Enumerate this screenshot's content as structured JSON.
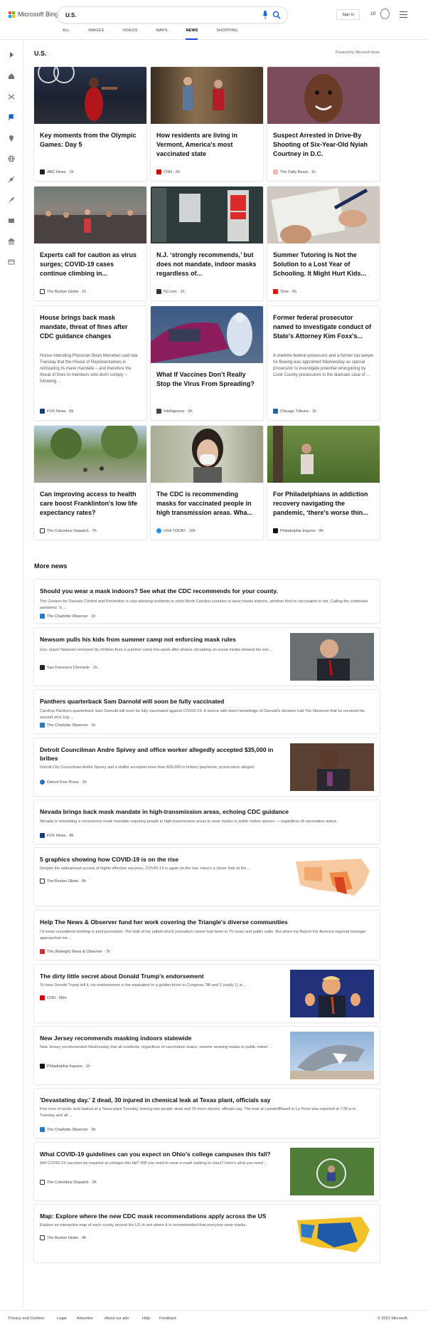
{
  "header": {
    "brand": "Microsoft Bing",
    "query": "U.S.",
    "sign_in": "Sign in",
    "points": "10",
    "tabs": [
      "ALL",
      "IMAGES",
      "VIDEOS",
      "MAPS",
      "NEWS",
      "SHOPPING"
    ]
  },
  "section": {
    "title": "U.S.",
    "powered_by": "Powered by Microsoft News"
  },
  "cards": [
    {
      "headline": "Key moments from the Olympic Games: Day 5",
      "source": "ABC News · 1h",
      "color": "#7b1416"
    },
    {
      "headline": "How residents are living in Vermont, America's most vaccinated state",
      "source": "CNN · 2h",
      "color": "#7a6650"
    },
    {
      "headline": "Suspect Arrested in Drive-By Shooting of Six-Year-Old Nyiah Courtney in D.C.",
      "source": "The Daily Beast · 1h",
      "color": "#6d4a4b"
    },
    {
      "headline": "Experts call for caution as virus surges; COVID-19 cases continue climbing in...",
      "source": "The Boston Globe · 1h",
      "color": "#5a5450"
    },
    {
      "headline": "N.J. ‘strongly recommends,’ but does not mandate, indoor masks regardless of...",
      "source": "NJ.com · 1h",
      "color": "#344143"
    },
    {
      "headline": "Summer Tutoring Is Not the Solution to a Lost Year of Schooling. It Might Hurt Kids...",
      "source": "Time · 5h",
      "color": "#c8c2bb"
    },
    {
      "headline": "House brings back mask mandate, threat of fines after CDC guidance changes",
      "snippet": "House Attending Physician Brian Monahan said late Tuesday that the House of Representatives is reinstating its mask mandate – and therefore the threat of fines to members who don't comply – following ...",
      "source": "FOX News · 5h"
    },
    {
      "headline": "What If Vaccines Don’t Really Stop the Virus From Spreading?",
      "source": "Intelligencer · 6h",
      "color": "#2b4f82"
    },
    {
      "headline": "Former federal prosecutor named to investigate conduct of State's Attorney Kim Foxx's...",
      "snippet": "A onetime federal prosecutor and a former top lawyer for Boeing was appointed Wednesday as special prosecutor to investigate potential wrongdoing by Cook County prosecutors in the dramatic case of ...",
      "source": "Chicago Tribune · 1h"
    },
    {
      "headline": "Can improving access to health care boost Franklinton's low life expectancy rates?",
      "source": "The Columbus Dispatch · 7h",
      "color": "#60774c"
    },
    {
      "headline": "The CDC is recommending masks for vaccinated people in high transmission areas. Wha...",
      "source": "USA TODAY · 10h",
      "color": "#8a8477"
    },
    {
      "headline": "For Philadelphians in addiction recovery navigating the pandemic, ‘there's worse thin...",
      "source": "Philadelphia Inquirer · 8h",
      "color": "#536d3b"
    }
  ],
  "more_news": {
    "title": "More news",
    "items": [
      {
        "title": "Should you wear a mask indoors? See what the CDC recommends for your county.",
        "snippet": "The Centers for Disease Control and Prevention is now advising residents in most North Carolina counties to wear masks indoors, whether they're vaccinated or not. Calling the continued pandemic \"a ...",
        "source": "The Charlotte Observer · 1h"
      },
      {
        "title": "Newsom pulls his kids from summer camp not enforcing mask rules",
        "snippet": "Gov. Gavin Newsom removed his children from a summer camp this week after photos circulating on social media showed his son ...",
        "source": "San Francisco Chronicle · 1h"
      },
      {
        "title": "Panthers quarterback Sam Darnold will soon be fully vaccinated",
        "snippet": "Carolina Panthers quarterback Sam Darnold will soon be fully vaccinated against COVID-19. A source with direct knowledge of Darnold's decision told The Observer that he received his second shot July ...",
        "source": "The Charlotte Observer · 1h"
      },
      {
        "title": "Detroit Councilman Andre Spivey and office worker allegedly accepted $35,000 in bribes",
        "snippet": "Detroit City Councilman Andre Spivey and a staffer accepted more than $35,000 in bribery payments, prosecutors alleged.",
        "source": "Detroit Free Press · 2h"
      },
      {
        "title": "Nevada brings back mask mandate in high-transmission areas, echoing CDC guidance",
        "snippet": "Nevada is reinstating a coronavirus mask mandate requiring people in high-transmission areas to wear masks in public indoor spaces — regardless of vaccination status.",
        "source": "FOX News · 8h"
      },
      {
        "title": "5 graphics showing how COVID-19 is on the rise",
        "snippet": "Despite the widespread access of highly effective vaccines, COVID-19 is again on the rise. Here's a closer look at the ...",
        "source": "The Boston Globe · 6h"
      },
      {
        "title": "Help The News & Observer fund her work covering the Triangle's diverse communities",
        "snippet": "I'd never considered working in print journalism. The bulk of my (albeit short) journalism career had been in TV news and public radio. But when my Report For America regional manager approached me ...",
        "source": "The (Raleigh) News & Observer · 7h"
      },
      {
        "title": "The dirty little secret about Donald Trump's endorsement",
        "snippet": "To hear Donald Trump tell it, his endorsement is the equivalent to a golden ticket to Congress.\"88 and 2 (really 1) in ...",
        "source": "CNN · 58m"
      },
      {
        "title": "New Jersey recommends masking indoors statewide",
        "snippet": "New Jersey recommended Wednesday that all residents, regardless of vaccination status, resume wearing masks in public indoor ...",
        "source": "Philadelphia Inquirer · 1h"
      },
      {
        "title": "'Devastating day.' 2 dead, 30 injured in chemical leak at Texas plant, officials say",
        "snippet": "Five tons of acetic acid leaked at a Texas plant Tuesday, leaving two people dead and 30 more injured, officials say. The leak at LyondellBasell in La Porte was reported at 7:35 p.m. Tuesday and all ...",
        "source": "The Charlotte Observer · 2h"
      },
      {
        "title": "What COVID-19 guidelines can you expect on Ohio's college campuses this fall?",
        "snippet": "Will COVID-19 vaccines be required at colleges this fall? Will you need to wear a mask walking to class? Here's what you need ...",
        "source": "The Columbus Dispatch · 3h"
      },
      {
        "title": "Map: Explore where the new CDC mask recommendations apply across the US",
        "snippet": "Explore an interactive map of each county around the US to see where it is recommended that everyone wear masks.",
        "source": "The Boston Globe · 4h"
      }
    ]
  },
  "footer": {
    "links": [
      "Privacy and Cookies",
      "Legal",
      "Advertise",
      "About our ads",
      "Help",
      "Feedback"
    ],
    "copyright": "© 2021 Microsoft"
  }
}
